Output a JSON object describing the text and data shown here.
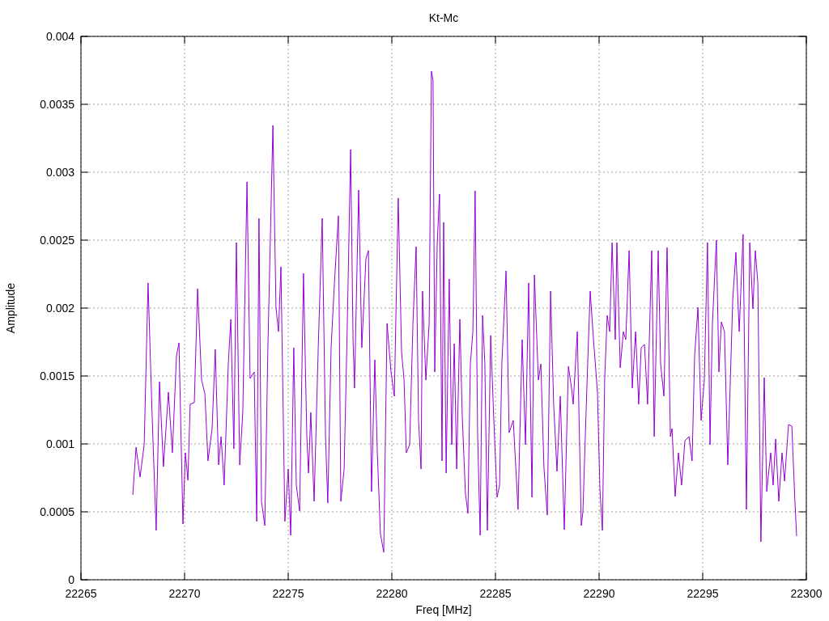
{
  "chart_data": {
    "type": "line",
    "grid": true,
    "title": "Kt-Mc",
    "xlabel": "Freq [MHz]",
    "ylabel": "Amplitude",
    "xlim": [
      22265,
      22300
    ],
    "ylim": [
      0,
      0.004
    ],
    "xticks": [
      22265,
      22270,
      22275,
      22280,
      22285,
      22290,
      22295,
      22300
    ],
    "yticks": [
      {
        "value": 0,
        "label": "0"
      },
      {
        "value": 0.0005,
        "label": "0.0005"
      },
      {
        "value": 0.001,
        "label": "0.001"
      },
      {
        "value": 0.0015,
        "label": "0.0015"
      },
      {
        "value": 0.002,
        "label": "0.002"
      },
      {
        "value": 0.0025,
        "label": "0.0025"
      },
      {
        "value": 0.003,
        "label": "0.003"
      },
      {
        "value": 0.0035,
        "label": "0.0035"
      },
      {
        "value": 0.004,
        "label": "0.004"
      }
    ],
    "x": [
      22267.5,
      22267.66,
      22267.85,
      22268.05,
      22268.24,
      22268.44,
      22268.63,
      22268.79,
      22268.98,
      22269.22,
      22269.41,
      22269.61,
      22269.73,
      22269.92,
      22270.04,
      22270.16,
      22270.27,
      22270.47,
      22270.63,
      22270.82,
      22270.98,
      22271.13,
      22271.33,
      22271.48,
      22271.64,
      22271.76,
      22271.91,
      22272.11,
      22272.23,
      22272.38,
      22272.5,
      22272.66,
      22272.81,
      22273.01,
      22273.16,
      22273.36,
      22273.48,
      22273.59,
      22273.71,
      22273.87,
      22274.02,
      22274.26,
      22274.41,
      22274.53,
      22274.65,
      22274.84,
      22275.0,
      22275.12,
      22275.27,
      22275.39,
      22275.55,
      22275.74,
      22275.9,
      22275.98,
      22276.09,
      22276.25,
      22276.45,
      22276.64,
      22276.8,
      22276.91,
      22277.07,
      22277.23,
      22277.42,
      22277.54,
      22277.7,
      22277.85,
      22278.01,
      22278.13,
      22278.2,
      22278.4,
      22278.55,
      22278.75,
      22278.87,
      22279.02,
      22279.18,
      22279.3,
      22279.45,
      22279.61,
      22279.77,
      22279.96,
      22280.12,
      22280.31,
      22280.47,
      22280.59,
      22280.7,
      22280.86,
      22281.02,
      22281.17,
      22281.29,
      22281.41,
      22281.48,
      22281.64,
      22281.8,
      22281.91,
      22281.99,
      22282.07,
      22282.19,
      22282.3,
      22282.42,
      22282.5,
      22282.62,
      22282.77,
      22282.89,
      22283.01,
      22283.13,
      22283.28,
      22283.4,
      22283.55,
      22283.67,
      22283.79,
      22283.91,
      22284.02,
      22284.14,
      22284.26,
      22284.38,
      22284.49,
      22284.61,
      22284.77,
      22284.92,
      22285.08,
      22285.2,
      22285.31,
      22285.51,
      22285.66,
      22285.86,
      22286.09,
      22286.29,
      22286.45,
      22286.6,
      22286.76,
      22286.88,
      22287.07,
      22287.19,
      22287.34,
      22287.5,
      22287.66,
      22287.81,
      22287.97,
      22288.13,
      22288.32,
      22288.52,
      22288.67,
      22288.75,
      22288.95,
      22289.14,
      22289.22,
      22289.41,
      22289.57,
      22289.73,
      22289.92,
      22290.04,
      22290.16,
      22290.27,
      22290.39,
      22290.51,
      22290.63,
      22290.78,
      22290.86,
      22291.02,
      22291.17,
      22291.29,
      22291.45,
      22291.6,
      22291.76,
      22291.91,
      22292.03,
      22292.19,
      22292.34,
      22292.54,
      22292.66,
      22292.85,
      22292.97,
      22293.13,
      22293.28,
      22293.44,
      22293.52,
      22293.67,
      22293.83,
      22293.98,
      22294.14,
      22294.34,
      22294.49,
      22294.61,
      22294.77,
      22294.92,
      22295.08,
      22295.23,
      22295.35,
      22295.47,
      22295.66,
      22295.78,
      22295.9,
      22296.05,
      22296.21,
      22296.45,
      22296.6,
      22296.76,
      22296.95,
      22297.11,
      22297.27,
      22297.42,
      22297.54,
      22297.66,
      22297.81,
      22297.97,
      22298.09,
      22298.28,
      22298.4,
      22298.52,
      22298.67,
      22298.83,
      22298.95,
      22299.14,
      22299.3,
      22299.45,
      22299.53
    ],
    "series": [
      {
        "color": "#9400d3",
        "values": [
          0.000625,
          0.000976,
          0.000756,
          0.000994,
          0.002185,
          0.001173,
          0.000363,
          0.001458,
          0.000833,
          0.001381,
          0.000935,
          0.001649,
          0.001744,
          0.000411,
          0.000935,
          0.000732,
          0.001292,
          0.001304,
          0.002143,
          0.00147,
          0.001369,
          0.000875,
          0.001113,
          0.001696,
          0.000845,
          0.001054,
          0.000696,
          0.001589,
          0.001917,
          0.000964,
          0.002482,
          0.000845,
          0.001232,
          0.002929,
          0.001482,
          0.00153,
          0.000429,
          0.002661,
          0.000577,
          0.000399,
          0.001708,
          0.003345,
          0.002006,
          0.001827,
          0.002304,
          0.000429,
          0.000815,
          0.000327,
          0.001708,
          0.000696,
          0.000506,
          0.002256,
          0.001054,
          0.000786,
          0.001232,
          0.000577,
          0.001708,
          0.002661,
          0.001054,
          0.000565,
          0.001708,
          0.002185,
          0.002679,
          0.000577,
          0.000815,
          0.001887,
          0.003167,
          0.001768,
          0.001411,
          0.002869,
          0.001708,
          0.002363,
          0.002423,
          0.000649,
          0.001619,
          0.000935,
          0.000339,
          0.000202,
          0.001887,
          0.00153,
          0.001351,
          0.00281,
          0.001679,
          0.00147,
          0.000935,
          0.000994,
          0.001887,
          0.002452,
          0.001173,
          0.000815,
          0.002125,
          0.00147,
          0.001887,
          0.003744,
          0.003673,
          0.00153,
          0.002482,
          0.002839,
          0.000875,
          0.002631,
          0.000786,
          0.002214,
          0.000994,
          0.001738,
          0.000815,
          0.001917,
          0.001202,
          0.000637,
          0.000488,
          0.001589,
          0.001827,
          0.002863,
          0.001054,
          0.000327,
          0.001946,
          0.001589,
          0.000363,
          0.001798,
          0.001173,
          0.000607,
          0.000696,
          0.001589,
          0.002274,
          0.001083,
          0.001173,
          0.000518,
          0.001768,
          0.000994,
          0.002185,
          0.000607,
          0.002244,
          0.00147,
          0.001589,
          0.000827,
          0.000476,
          0.002125,
          0.001292,
          0.000798,
          0.001351,
          0.000369,
          0.001571,
          0.001411,
          0.001292,
          0.001827,
          0.000399,
          0.0005,
          0.001411,
          0.002125,
          0.001768,
          0.001381,
          0.000667,
          0.000363,
          0.00147,
          0.001946,
          0.001827,
          0.002482,
          0.001768,
          0.002482,
          0.00156,
          0.001827,
          0.001768,
          0.002423,
          0.001411,
          0.001827,
          0.001292,
          0.001708,
          0.001732,
          0.001292,
          0.002423,
          0.001054,
          0.002423,
          0.001589,
          0.001351,
          0.002446,
          0.001054,
          0.001113,
          0.000613,
          0.000935,
          0.000696,
          0.001024,
          0.001054,
          0.000875,
          0.001649,
          0.002006,
          0.001173,
          0.00147,
          0.002482,
          0.000994,
          0.001887,
          0.0025,
          0.00153,
          0.001899,
          0.001827,
          0.000845,
          0.002065,
          0.002411,
          0.001827,
          0.002542,
          0.000518,
          0.002482,
          0.001994,
          0.002423,
          0.002185,
          0.00028,
          0.001488,
          0.000649,
          0.000935,
          0.000696,
          0.001036,
          0.000577,
          0.000935,
          0.000726,
          0.001143,
          0.001131,
          0.000577,
          0.000321
        ]
      }
    ]
  }
}
